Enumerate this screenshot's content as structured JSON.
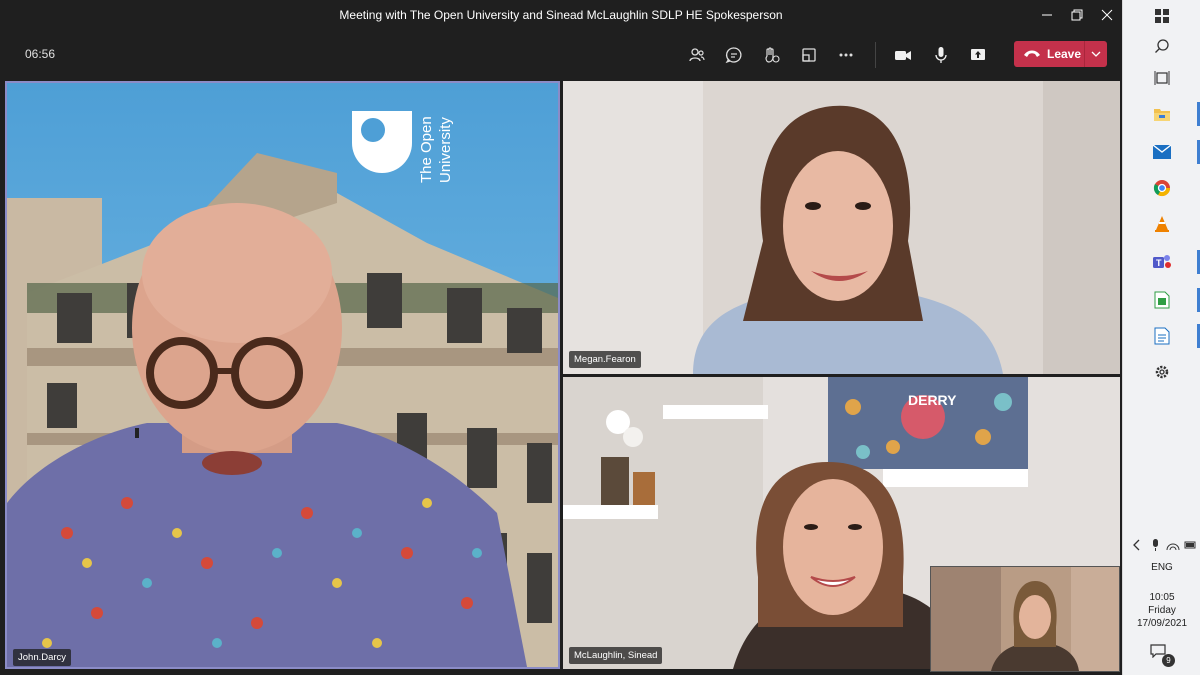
{
  "window": {
    "title": "Meeting with The Open University and Sinead McLaughlin SDLP HE Spokesperson"
  },
  "meeting": {
    "elapsed": "06:56",
    "leave_label": "Leave",
    "leave_color": "#c4314b",
    "toolbar_icons": [
      "people-icon",
      "chat-icon",
      "reactions-icon",
      "rooms-icon",
      "more-icon",
      "camera-icon",
      "microphone-icon",
      "share-icon"
    ]
  },
  "participants": [
    {
      "name": "John.Darcy",
      "background_logo": [
        "The Open",
        "University"
      ]
    },
    {
      "name": "Megan.Fearon"
    },
    {
      "name": "McLaughlin, Sinead",
      "poster_text": "DERRY"
    }
  ],
  "taskbar": {
    "apps": [
      "windows-start-icon",
      "search-icon",
      "task-view-icon",
      "file-explorer-icon",
      "mail-icon",
      "chrome-icon",
      "vlc-icon",
      "teams-icon",
      "spreadsheet-icon",
      "document-icon",
      "settings-icon"
    ],
    "language": "ENG",
    "time": "10:05",
    "day": "Friday",
    "date": "17/09/2021",
    "notifications": "9"
  }
}
